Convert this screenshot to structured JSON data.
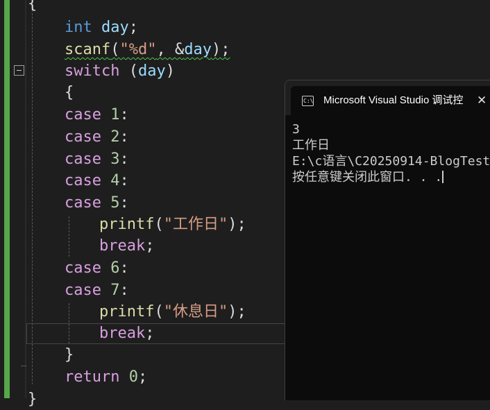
{
  "editor": {
    "top_brace": "{",
    "lines": {
      "decl_type": "int",
      "decl_var": "day",
      "decl_semicolon": ";",
      "scanf_fn": "scanf",
      "scanf_open": "(",
      "scanf_fmt": "\"%d\"",
      "scanf_sep": ", &",
      "scanf_var": "day",
      "scanf_close": ");",
      "switch_kw": "switch",
      "switch_open": " (",
      "switch_var": "day",
      "switch_close": ")",
      "open_brace": "{",
      "case_kw": "case",
      "case_values": [
        "1",
        "2",
        "3",
        "4",
        "5",
        "6",
        "7"
      ],
      "colon": ":",
      "printf_fn": "printf",
      "printf_open": "(",
      "printf1_str": "\"工作日\"",
      "printf2_str": "\"休息日\"",
      "printf_close": ");",
      "break_kw": "break",
      "semicolon": ";",
      "close_brace": "}",
      "return_kw": "return",
      "return_space": " ",
      "return_val": "0",
      "bottom_brace": "}"
    }
  },
  "console": {
    "title": "Microsoft Visual Studio 调试控",
    "icon_text": "C:\\",
    "close_icon": "close-icon",
    "output": [
      "3",
      "工作日",
      "E:\\c语言\\C20250914-BlogTest",
      "按任意键关闭此窗口. . ."
    ]
  },
  "colors": {
    "background": "#1e1e1e",
    "change_bar": "#57a64a",
    "keyword": "#569cd6",
    "control": "#d8a0df",
    "function": "#dcdcaa",
    "variable": "#9cdcfe",
    "string": "#d69d85",
    "number": "#b5cea8",
    "console_bg": "#0c0c0c"
  }
}
